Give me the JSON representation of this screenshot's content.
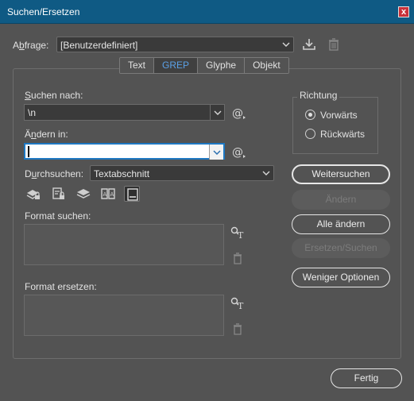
{
  "window": {
    "title": "Suchen/Ersetzen",
    "close_glyph": "x"
  },
  "query": {
    "label_prefix": "A",
    "label_underlined": "b",
    "label_suffix": "frage:",
    "value": "[Benutzerdefiniert]"
  },
  "tabs": [
    {
      "label": "Text",
      "selected": false
    },
    {
      "label": "GREP",
      "selected": true
    },
    {
      "label": "Glyphe",
      "selected": false
    },
    {
      "label": "Objekt",
      "selected": false
    }
  ],
  "search": {
    "label_underlined": "S",
    "label_rest": "uchen nach:",
    "value": "\\n"
  },
  "replace": {
    "label_prefix": "Ä",
    "label_underlined": "n",
    "label_rest": "dern in:",
    "value": ""
  },
  "scope": {
    "label_prefix": "D",
    "label_underlined": "u",
    "label_rest": "rchsuchen:",
    "value": "Textabschnitt"
  },
  "direction": {
    "legend": "Richtung",
    "options": [
      {
        "label": "Vorwärts",
        "selected": true
      },
      {
        "label": "Rückwärts",
        "selected": false
      }
    ]
  },
  "format_find": {
    "label": "Format suchen:"
  },
  "format_replace": {
    "label": "Format ersetzen:"
  },
  "buttons": {
    "find_next": "Weitersuchen",
    "change": "Ändern",
    "change_all": "Alle ändern",
    "change_find": "Ersetzen/Suchen",
    "fewer_options": "Weniger Optionen",
    "done": "Fertig"
  },
  "colors": {
    "titlebar": "#0f5a84",
    "background": "#535353",
    "accent": "#1e78c2",
    "tab_selected_text": "#5aa0e6"
  }
}
